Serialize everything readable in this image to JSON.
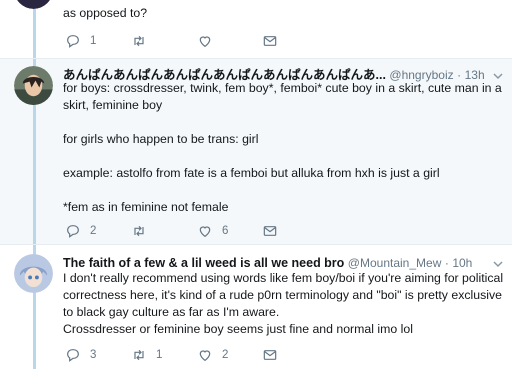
{
  "tweets": [
    {
      "text": "as opposed to?",
      "replies": "1",
      "retweets": "",
      "likes": ""
    },
    {
      "name": "あんぱんあんぱんあんぱんあんぱんあんぱんあんぱんあ...",
      "handle": "@hngryboiz",
      "dot": "·",
      "time": "13h",
      "paragraphs": [
        "for boys: crossdresser, twink, fem boy*, femboi* cute boy in a skirt, cute man in a skirt, feminine boy",
        "for girls who happen to be trans: girl",
        "example: astolfo from fate is a femboi but alluka from hxh is just a girl",
        "*fem as in feminine not female"
      ],
      "replies": "2",
      "retweets": "",
      "likes": "6"
    },
    {
      "name": "The faith of a few & a lil weed is all we need bro",
      "handle": "@Mountain_Mew",
      "dot": "·",
      "time": "10h",
      "paragraphs": [
        "I don't really recommend using words like fem boy/boi if you're aiming for political correctness here, it's kind of a rude p0rn terminology and \"boi\" is pretty exclusive to black gay culture as far as I'm aware.\nCrossdresser or feminine boy seems just fine and normal imo lol"
      ],
      "replies": "3",
      "retweets": "1",
      "likes": "2"
    }
  ],
  "icons": {
    "reply": "reply-icon",
    "retweet": "retweet-icon",
    "like": "heart-icon",
    "dm": "envelope-icon",
    "more": "chevron-down-icon"
  },
  "colors": {
    "thread_line": "#b9d6ea",
    "highlight_bg": "#f5f8fa",
    "muted": "#657786"
  }
}
